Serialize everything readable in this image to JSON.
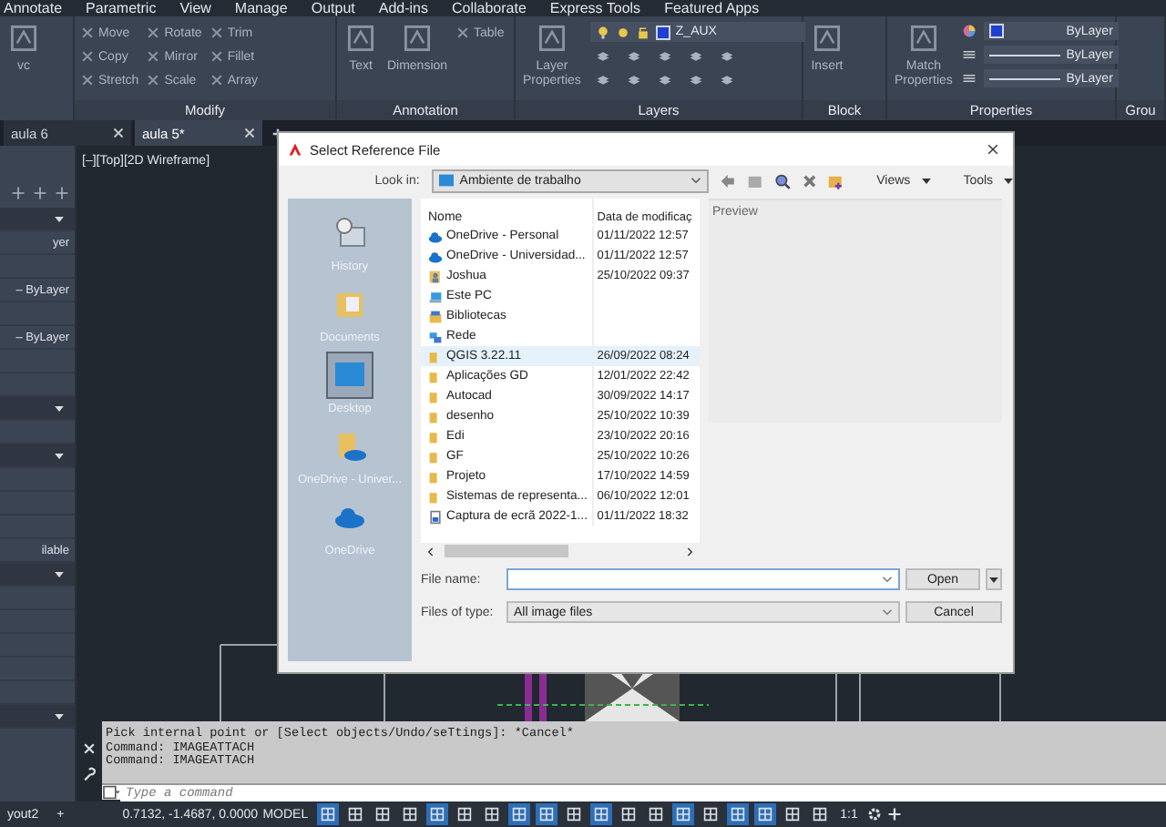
{
  "menu_bar": [
    "Annotate",
    "Parametric",
    "View",
    "Manage",
    "Output",
    "Add-ins",
    "Collaborate",
    "Express Tools",
    "Featured Apps"
  ],
  "ribbon": [
    {
      "kind": "draw",
      "large_tools": [
        [
          "vc"
        ]
      ]
    },
    {
      "kind": "modify",
      "title": "Modify",
      "small_tools": [
        "Move",
        "Rotate",
        "Trim",
        "Copy",
        "Mirror",
        "Fillet",
        "Stretch",
        "Scale",
        "Array"
      ]
    },
    {
      "kind": "annotation",
      "title": "Annotation",
      "large_tools": [
        [
          "Text"
        ],
        [
          "Dimension"
        ]
      ],
      "small_tools": [
        "Table"
      ]
    },
    {
      "kind": "layers",
      "title": "Layers",
      "layer": "Z_AUX",
      "large_tools": [
        [
          "Layer",
          "Properties"
        ]
      ]
    },
    {
      "kind": "block",
      "title": "Block",
      "large_tools": [
        [
          "Insert"
        ]
      ]
    },
    {
      "kind": "properties",
      "title": "Properties",
      "values": [
        "ByLayer",
        "ByLayer",
        "ByLayer"
      ],
      "large_tools": [
        [
          "Match",
          "Properties"
        ]
      ]
    },
    {
      "kind": "group",
      "title": "Grou"
    }
  ],
  "file_tabs": [
    {
      "label": "aula 6",
      "selected": false
    },
    {
      "label": "aula 5*",
      "selected": true
    }
  ],
  "palette": [
    {
      "kind": "header"
    },
    {
      "kind": "row",
      "label": "yer"
    },
    {
      "kind": "row"
    },
    {
      "kind": "row",
      "label": "– ByLayer"
    },
    {
      "kind": "row"
    },
    {
      "kind": "row",
      "label": "– ByLayer"
    },
    {
      "kind": "row"
    },
    {
      "kind": "row"
    },
    {
      "kind": "header"
    },
    {
      "kind": "row"
    },
    {
      "kind": "header"
    },
    {
      "kind": "row"
    },
    {
      "kind": "row"
    },
    {
      "kind": "row"
    },
    {
      "kind": "row",
      "label": "ilable"
    },
    {
      "kind": "header"
    },
    {
      "kind": "row"
    },
    {
      "kind": "row"
    },
    {
      "kind": "row"
    },
    {
      "kind": "row"
    },
    {
      "kind": "row"
    },
    {
      "kind": "header"
    }
  ],
  "viewport_label": "[–][Top][2D Wireframe]",
  "dialog": {
    "title": "Select Reference File",
    "look_in_label": "Look in:",
    "look_in": "Ambiente de trabalho",
    "views": "Views",
    "tools": "Tools",
    "places": [
      {
        "label": "History",
        "kind": "history",
        "selected": false
      },
      {
        "label": "Documents",
        "kind": "documents",
        "selected": false
      },
      {
        "label": "Desktop",
        "kind": "desktop",
        "selected": true
      },
      {
        "label": "OneDrive - Univer...",
        "kind": "onedrive-folder",
        "selected": false
      },
      {
        "label": "OneDrive",
        "kind": "cloud",
        "selected": false
      }
    ],
    "columns": [
      "Nome",
      "Data de modificaç"
    ],
    "files": [
      {
        "name": "OneDrive - Personal",
        "date": "01/11/2022 12:57",
        "kind": "cloud",
        "selected": false
      },
      {
        "name": "OneDrive - Universidad...",
        "date": "01/11/2022 12:57",
        "kind": "cloud",
        "selected": false
      },
      {
        "name": "Joshua",
        "date": "25/10/2022 09:37",
        "kind": "user",
        "selected": false
      },
      {
        "name": "Este PC",
        "kind": "pc",
        "selected": false
      },
      {
        "name": "Bibliotecas",
        "kind": "library",
        "selected": false
      },
      {
        "name": "Rede",
        "kind": "network",
        "selected": false
      },
      {
        "name": "QGIS 3.22.11",
        "date": "26/09/2022 08:24",
        "kind": "folder",
        "selected": true
      },
      {
        "name": "Aplicações GD",
        "date": "12/01/2022 22:42",
        "kind": "folder",
        "selected": false
      },
      {
        "name": "Autocad",
        "date": "30/09/2022 14:17",
        "kind": "folder",
        "selected": false
      },
      {
        "name": "desenho",
        "date": "25/10/2022 10:39",
        "kind": "folder",
        "selected": false
      },
      {
        "name": "Edi",
        "date": "23/10/2022 20:16",
        "kind": "folder",
        "selected": false
      },
      {
        "name": "GF",
        "date": "25/10/2022 10:26",
        "kind": "folder",
        "selected": false
      },
      {
        "name": "Projeto",
        "date": "17/10/2022 14:59",
        "kind": "folder",
        "selected": false
      },
      {
        "name": "Sistemas de representa...",
        "date": "06/10/2022 12:01",
        "kind": "folder",
        "selected": false
      },
      {
        "name": "Captura de ecrã 2022-1...",
        "date": "01/11/2022 18:32",
        "kind": "image",
        "selected": false
      }
    ],
    "preview_label": "Preview",
    "file_name_label": "File name:",
    "file_type_label": "Files of type:",
    "file_type": "All image files",
    "buttons": [
      "Open",
      "Cancel"
    ]
  },
  "command_history": [
    "Pick internal point or [Select objects/Undo/seTtings]: *Cancel*",
    "Command: IMAGEATTACH",
    "Command: IMAGEATTACH"
  ],
  "command_placeholder": "Type a command",
  "status_bar": {
    "layout_tab": "yout2",
    "add_tab": "+",
    "coordinates": "0.7132, -1.4687, 0.0000",
    "space": "MODEL",
    "scale": "1:1",
    "toggles": [
      {
        "on": true
      },
      {
        "on": false
      },
      {
        "on": false
      },
      {
        "on": false
      },
      {
        "on": true
      },
      {
        "on": false
      },
      {
        "on": false
      },
      {
        "on": true
      },
      {
        "on": true
      },
      {
        "on": false
      },
      {
        "on": true
      },
      {
        "on": false
      },
      {
        "on": false
      },
      {
        "on": true
      },
      {
        "on": false
      },
      {
        "on": true
      },
      {
        "on": true
      },
      {
        "on": false
      },
      {
        "on": false
      }
    ]
  }
}
